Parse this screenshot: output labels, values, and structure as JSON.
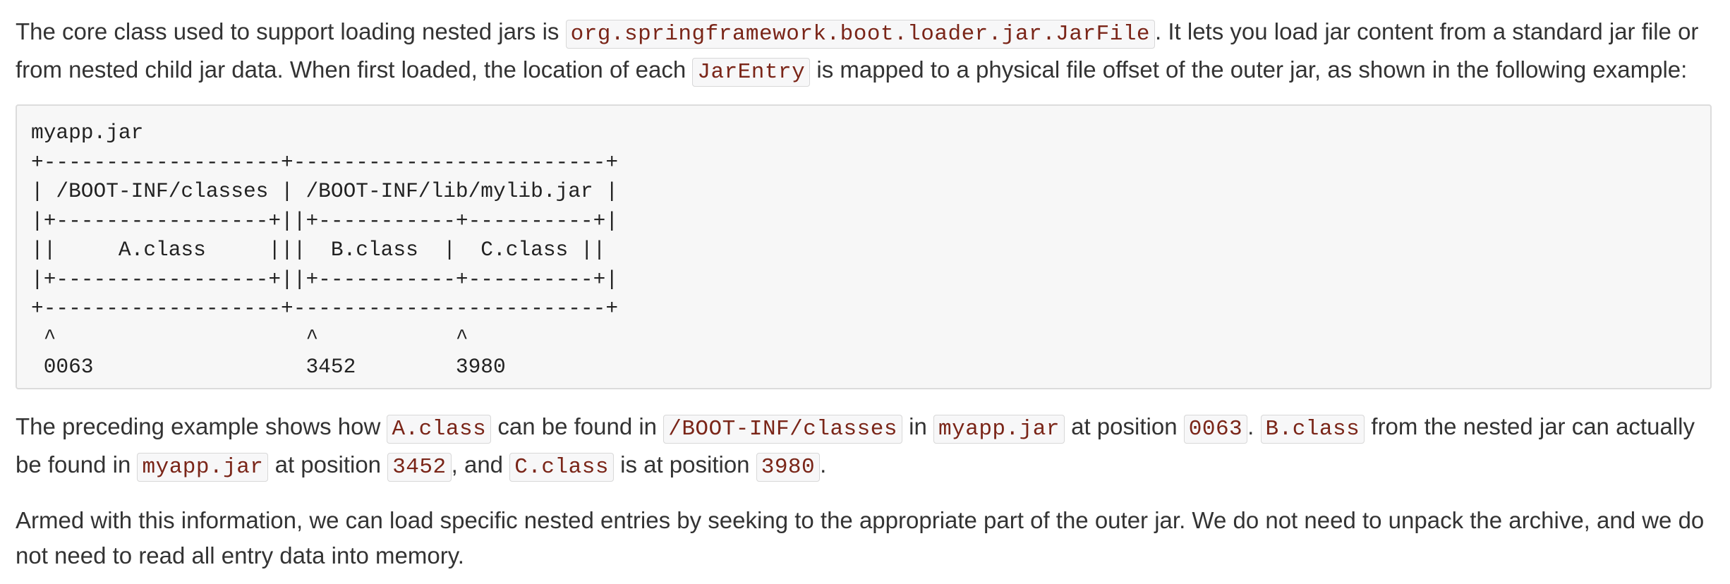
{
  "paragraph1": {
    "t1": "The core class used to support loading nested jars is ",
    "c1": "org.springframework.boot.loader.jar.JarFile",
    "t2": ". It lets you load jar content from a standard jar file or from nested child jar data. When first loaded, the location of each ",
    "c2": "JarEntry",
    "t3": " is mapped to a physical file offset of the outer jar, as shown in the following example:"
  },
  "listing": "myapp.jar\n+-------------------+-------------------------+\n| /BOOT-INF/classes | /BOOT-INF/lib/mylib.jar |\n|+-----------------+||+-----------+----------+|\n||     A.class     |||  B.class  |  C.class ||\n|+-----------------+||+-----------+----------+|\n+-------------------+-------------------------+\n ^                    ^           ^\n 0063                 3452        3980",
  "paragraph2": {
    "t1": "The preceding example shows how ",
    "c1": "A.class",
    "t2": " can be found in ",
    "c2": "/BOOT-INF/classes",
    "t3": " in ",
    "c3": "myapp.jar",
    "t4": " at position ",
    "c4": "0063",
    "t5": ". ",
    "c5": "B.class",
    "t6": " from the nested jar can actually be found in ",
    "c6": "myapp.jar",
    "t7": " at position ",
    "c7": "3452",
    "t8": ", and ",
    "c8": "C.class",
    "t9": " is at position ",
    "c9": "3980",
    "t10": "."
  },
  "paragraph3": "Armed with this information, we can load specific nested entries by seeking to the appropriate part of the outer jar. We do not need to unpack the archive, and we do not need to read all entry data into memory.",
  "colors": {
    "text": "#333333",
    "code_text": "#7a2518",
    "code_bg": "#f7f7f8",
    "listing_bg": "#f7f7f7"
  }
}
